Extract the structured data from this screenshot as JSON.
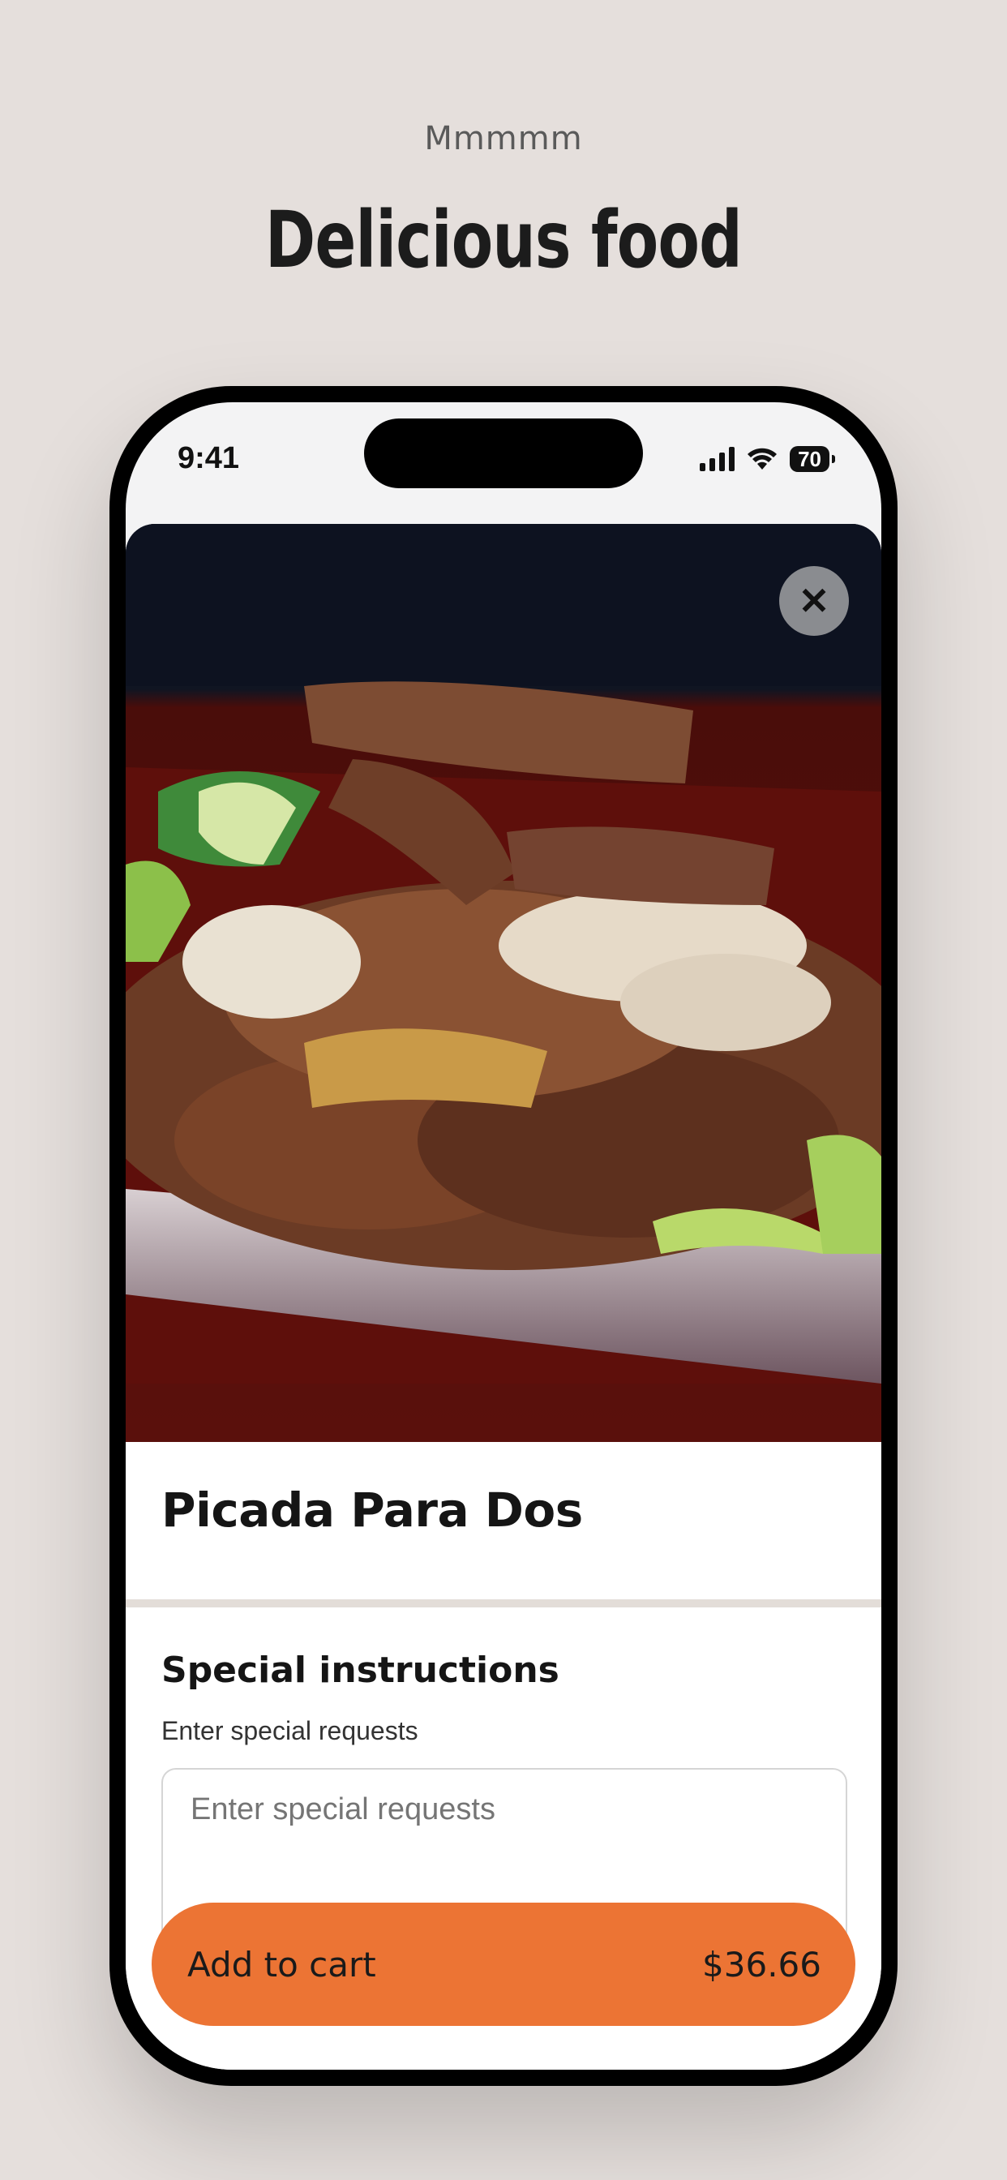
{
  "header": {
    "eyebrow": "Mmmmm",
    "title": "Delicious food"
  },
  "status_bar": {
    "time": "9:41",
    "battery": "70",
    "icons": [
      "signal-icon",
      "wifi-icon",
      "battery-icon"
    ]
  },
  "item": {
    "photo_icon": "food-photo",
    "name": "Picada Para Dos",
    "close_icon": "close-icon"
  },
  "instructions": {
    "title": "Special instructions",
    "subtitle": "Enter special requests",
    "placeholder": "Enter special requests"
  },
  "cart": {
    "label": "Add to cart",
    "price": "$36.66"
  },
  "colors": {
    "background": "#e5dfdc",
    "accent": "#ec7434"
  }
}
